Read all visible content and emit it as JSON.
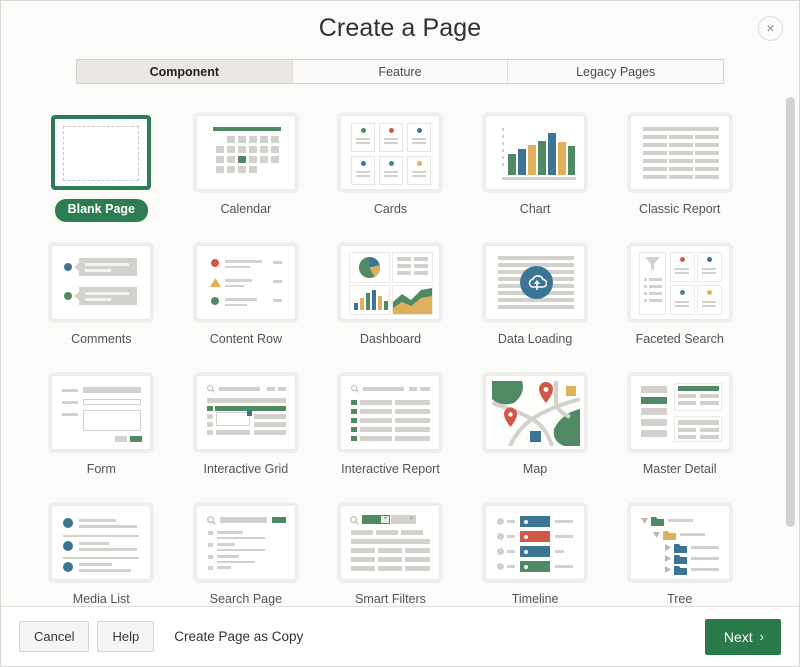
{
  "dialog": {
    "title": "Create a Page",
    "close_label": "×",
    "close_icon": "close-icon"
  },
  "tabs": [
    {
      "label": "Component",
      "active": true
    },
    {
      "label": "Feature",
      "active": false
    },
    {
      "label": "Legacy Pages",
      "active": false
    }
  ],
  "tiles": [
    {
      "label": "Blank Page",
      "icon": "blank-page-icon",
      "selected": true
    },
    {
      "label": "Calendar",
      "icon": "calendar-icon",
      "selected": false
    },
    {
      "label": "Cards",
      "icon": "cards-icon",
      "selected": false
    },
    {
      "label": "Chart",
      "icon": "chart-icon",
      "selected": false
    },
    {
      "label": "Classic Report",
      "icon": "classic-report-icon",
      "selected": false
    },
    {
      "label": "Comments",
      "icon": "comments-icon",
      "selected": false
    },
    {
      "label": "Content Row",
      "icon": "content-row-icon",
      "selected": false
    },
    {
      "label": "Dashboard",
      "icon": "dashboard-icon",
      "selected": false
    },
    {
      "label": "Data Loading",
      "icon": "data-loading-icon",
      "selected": false
    },
    {
      "label": "Faceted Search",
      "icon": "faceted-search-icon",
      "selected": false
    },
    {
      "label": "Form",
      "icon": "form-icon",
      "selected": false
    },
    {
      "label": "Interactive Grid",
      "icon": "interactive-grid-icon",
      "selected": false
    },
    {
      "label": "Interactive Report",
      "icon": "interactive-report-icon",
      "selected": false
    },
    {
      "label": "Map",
      "icon": "map-icon",
      "selected": false
    },
    {
      "label": "Master Detail",
      "icon": "master-detail-icon",
      "selected": false
    },
    {
      "label": "Media List",
      "icon": "media-list-icon",
      "selected": false
    },
    {
      "label": "Search Page",
      "icon": "search-page-icon",
      "selected": false
    },
    {
      "label": "Smart Filters",
      "icon": "smart-filters-icon",
      "selected": false
    },
    {
      "label": "Timeline",
      "icon": "timeline-icon",
      "selected": false
    },
    {
      "label": "Tree",
      "icon": "tree-icon",
      "selected": false
    }
  ],
  "footer": {
    "cancel_label": "Cancel",
    "help_label": "Help",
    "create_as_copy_label": "Create Page as Copy",
    "next_label": "Next",
    "next_chevron": "›"
  },
  "colors": {
    "accent_green": "#2e7d52",
    "button_green": "#2b7a4b",
    "icon_green": "#4f8a64",
    "icon_blue": "#3c7494",
    "icon_gold": "#e0b05c",
    "icon_red": "#d05a48",
    "icon_gray": "#d3d1cc",
    "dialog_bg": "#fbfbfa"
  }
}
